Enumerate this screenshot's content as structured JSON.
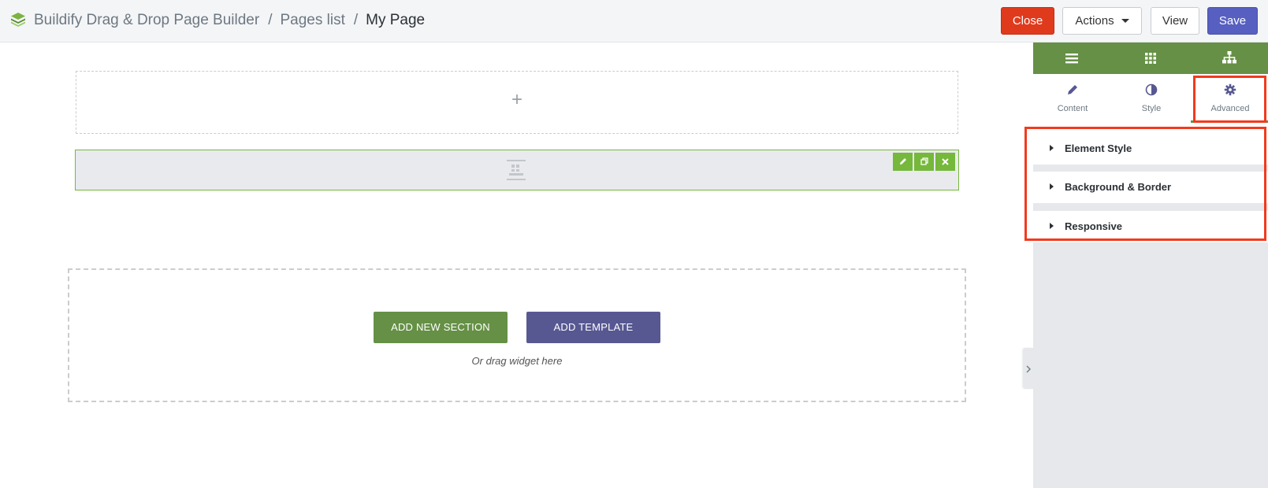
{
  "breadcrumb": {
    "app": "Buildify Drag & Drop Page Builder",
    "separator": "/",
    "pages_list": "Pages list",
    "current": "My Page"
  },
  "toolbar": {
    "close_label": "Close",
    "actions_label": "Actions",
    "view_label": "View",
    "save_label": "Save"
  },
  "canvas": {
    "add_icon": "+",
    "section_tools": [
      "pencil-icon",
      "copy-icon",
      "close-icon"
    ],
    "add_section_label": "ADD NEW SECTION",
    "add_template_label": "ADD TEMPLATE",
    "drag_hint": "Or drag widget here"
  },
  "panel": {
    "header_icons": [
      "menu-icon",
      "grid-icon",
      "sitemap-icon"
    ],
    "tabs": [
      {
        "label": "Content",
        "icon": "pencil-icon"
      },
      {
        "label": "Style",
        "icon": "half-circle-icon"
      },
      {
        "label": "Advanced",
        "icon": "gear-icon",
        "active": true
      }
    ],
    "sections": [
      {
        "label": "Element Style"
      },
      {
        "label": "Background & Border"
      },
      {
        "label": "Responsive"
      }
    ]
  },
  "colors": {
    "brand_green": "#659045",
    "template_purple": "#575892",
    "close_red": "#e03a1d",
    "save_blue": "#5760c0",
    "highlight_red": "#f23a1d"
  }
}
